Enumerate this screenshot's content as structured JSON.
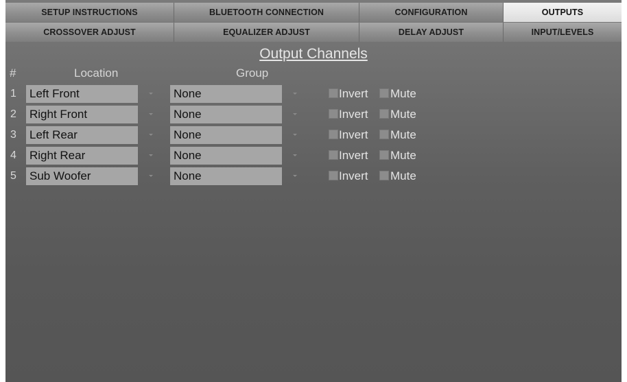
{
  "tabs": {
    "row1": [
      "SETUP INSTRUCTIONS",
      "BLUETOOTH CONNECTION",
      "CONFIGURATION",
      "OUTPUTS"
    ],
    "row2": [
      "CROSSOVER ADJUST",
      "EQUALIZER ADJUST",
      "DELAY ADJUST",
      "INPUT/LEVELS"
    ],
    "active": "OUTPUTS"
  },
  "panel": {
    "title": "Output Channels",
    "headers": {
      "num": "#",
      "location": "Location",
      "group": "Group"
    },
    "invert_label": "Invert",
    "mute_label": "Mute"
  },
  "channels": [
    {
      "num": "1",
      "location": "Left Front",
      "group": "None",
      "invert": false,
      "mute": false
    },
    {
      "num": "2",
      "location": "Right Front",
      "group": "None",
      "invert": false,
      "mute": false
    },
    {
      "num": "3",
      "location": "Left Rear",
      "group": "None",
      "invert": false,
      "mute": false
    },
    {
      "num": "4",
      "location": "Right Rear",
      "group": "None",
      "invert": false,
      "mute": false
    },
    {
      "num": "5",
      "location": "Sub Woofer",
      "group": "None",
      "invert": false,
      "mute": false
    }
  ],
  "colors": {
    "active_tab": "#e8e8e8",
    "tab": "#8f8f8f",
    "panel_bg": "#6a6a6a",
    "field_bg": "#a6a6a6"
  }
}
